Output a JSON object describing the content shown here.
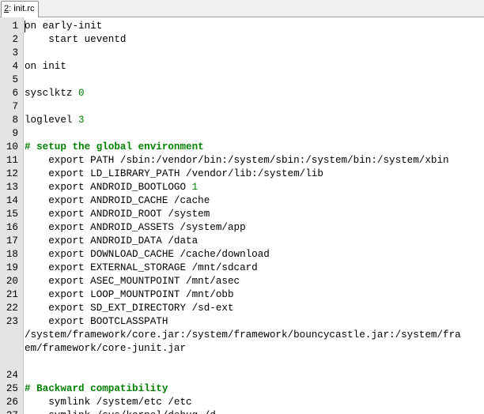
{
  "tab": {
    "number": "2",
    "name": ": init.rc"
  },
  "colors": {
    "comment": "#008000",
    "number": "#008000",
    "gutter": "#e4e4e4"
  },
  "lines": [
    {
      "n": "1",
      "parts": [
        {
          "t": "on early-init"
        }
      ]
    },
    {
      "n": "2",
      "parts": [
        {
          "t": "    start ueventd"
        }
      ]
    },
    {
      "n": "3",
      "parts": [
        {
          "t": ""
        }
      ]
    },
    {
      "n": "4",
      "parts": [
        {
          "t": "on init"
        }
      ]
    },
    {
      "n": "5",
      "parts": [
        {
          "t": ""
        }
      ]
    },
    {
      "n": "6",
      "parts": [
        {
          "t": "sysclktz "
        },
        {
          "t": "0",
          "c": "number"
        }
      ]
    },
    {
      "n": "7",
      "parts": [
        {
          "t": ""
        }
      ]
    },
    {
      "n": "8",
      "parts": [
        {
          "t": "loglevel "
        },
        {
          "t": "3",
          "c": "number"
        }
      ]
    },
    {
      "n": "9",
      "parts": [
        {
          "t": ""
        }
      ]
    },
    {
      "n": "10",
      "parts": [
        {
          "t": "# setup the global environment",
          "c": "comment"
        }
      ]
    },
    {
      "n": "11",
      "parts": [
        {
          "t": "    export PATH /sbin:/vendor/bin:/system/sbin:/system/bin:/system/xbin"
        }
      ]
    },
    {
      "n": "12",
      "parts": [
        {
          "t": "    export LD_LIBRARY_PATH /vendor/lib:/system/lib"
        }
      ]
    },
    {
      "n": "13",
      "parts": [
        {
          "t": "    export ANDROID_BOOTLOGO "
        },
        {
          "t": "1",
          "c": "number"
        }
      ]
    },
    {
      "n": "14",
      "parts": [
        {
          "t": "    export ANDROID_CACHE /cache"
        }
      ]
    },
    {
      "n": "15",
      "parts": [
        {
          "t": "    export ANDROID_ROOT /system"
        }
      ]
    },
    {
      "n": "16",
      "parts": [
        {
          "t": "    export ANDROID_ASSETS /system/app"
        }
      ]
    },
    {
      "n": "17",
      "parts": [
        {
          "t": "    export ANDROID_DATA /data"
        }
      ]
    },
    {
      "n": "18",
      "parts": [
        {
          "t": "    export DOWNLOAD_CACHE /cache/download"
        }
      ]
    },
    {
      "n": "19",
      "parts": [
        {
          "t": "    export EXTERNAL_STORAGE /mnt/sdcard"
        }
      ]
    },
    {
      "n": "20",
      "parts": [
        {
          "t": "    export ASEC_MOUNTPOINT /mnt/asec"
        }
      ]
    },
    {
      "n": "21",
      "parts": [
        {
          "t": "    export LOOP_MOUNTPOINT /mnt/obb"
        }
      ]
    },
    {
      "n": "22",
      "parts": [
        {
          "t": "    export SD_EXT_DIRECTORY /sd-ext"
        }
      ]
    },
    {
      "n": "23",
      "parts": [
        {
          "t": "    export BOOTCLASSPATH"
        }
      ]
    },
    {
      "n": "",
      "parts": [
        {
          "t": "/system/framework/core.jar:/system/framework/bouncycastle.jar:/system/fra"
        }
      ]
    },
    {
      "n": "",
      "parts": [
        {
          "t": "em/framework/core-junit.jar"
        }
      ]
    },
    {
      "n": "",
      "parts": [
        {
          "t": ""
        }
      ]
    },
    {
      "n": "24",
      "parts": [
        {
          "t": ""
        }
      ]
    },
    {
      "n": "25",
      "parts": [
        {
          "t": "# Backward compatibility",
          "c": "comment"
        }
      ]
    },
    {
      "n": "26",
      "parts": [
        {
          "t": "    symlink /system/etc /etc"
        }
      ]
    },
    {
      "n": "27",
      "parts": [
        {
          "t": "    symlink /sys/kernel/debug /d"
        }
      ]
    }
  ]
}
